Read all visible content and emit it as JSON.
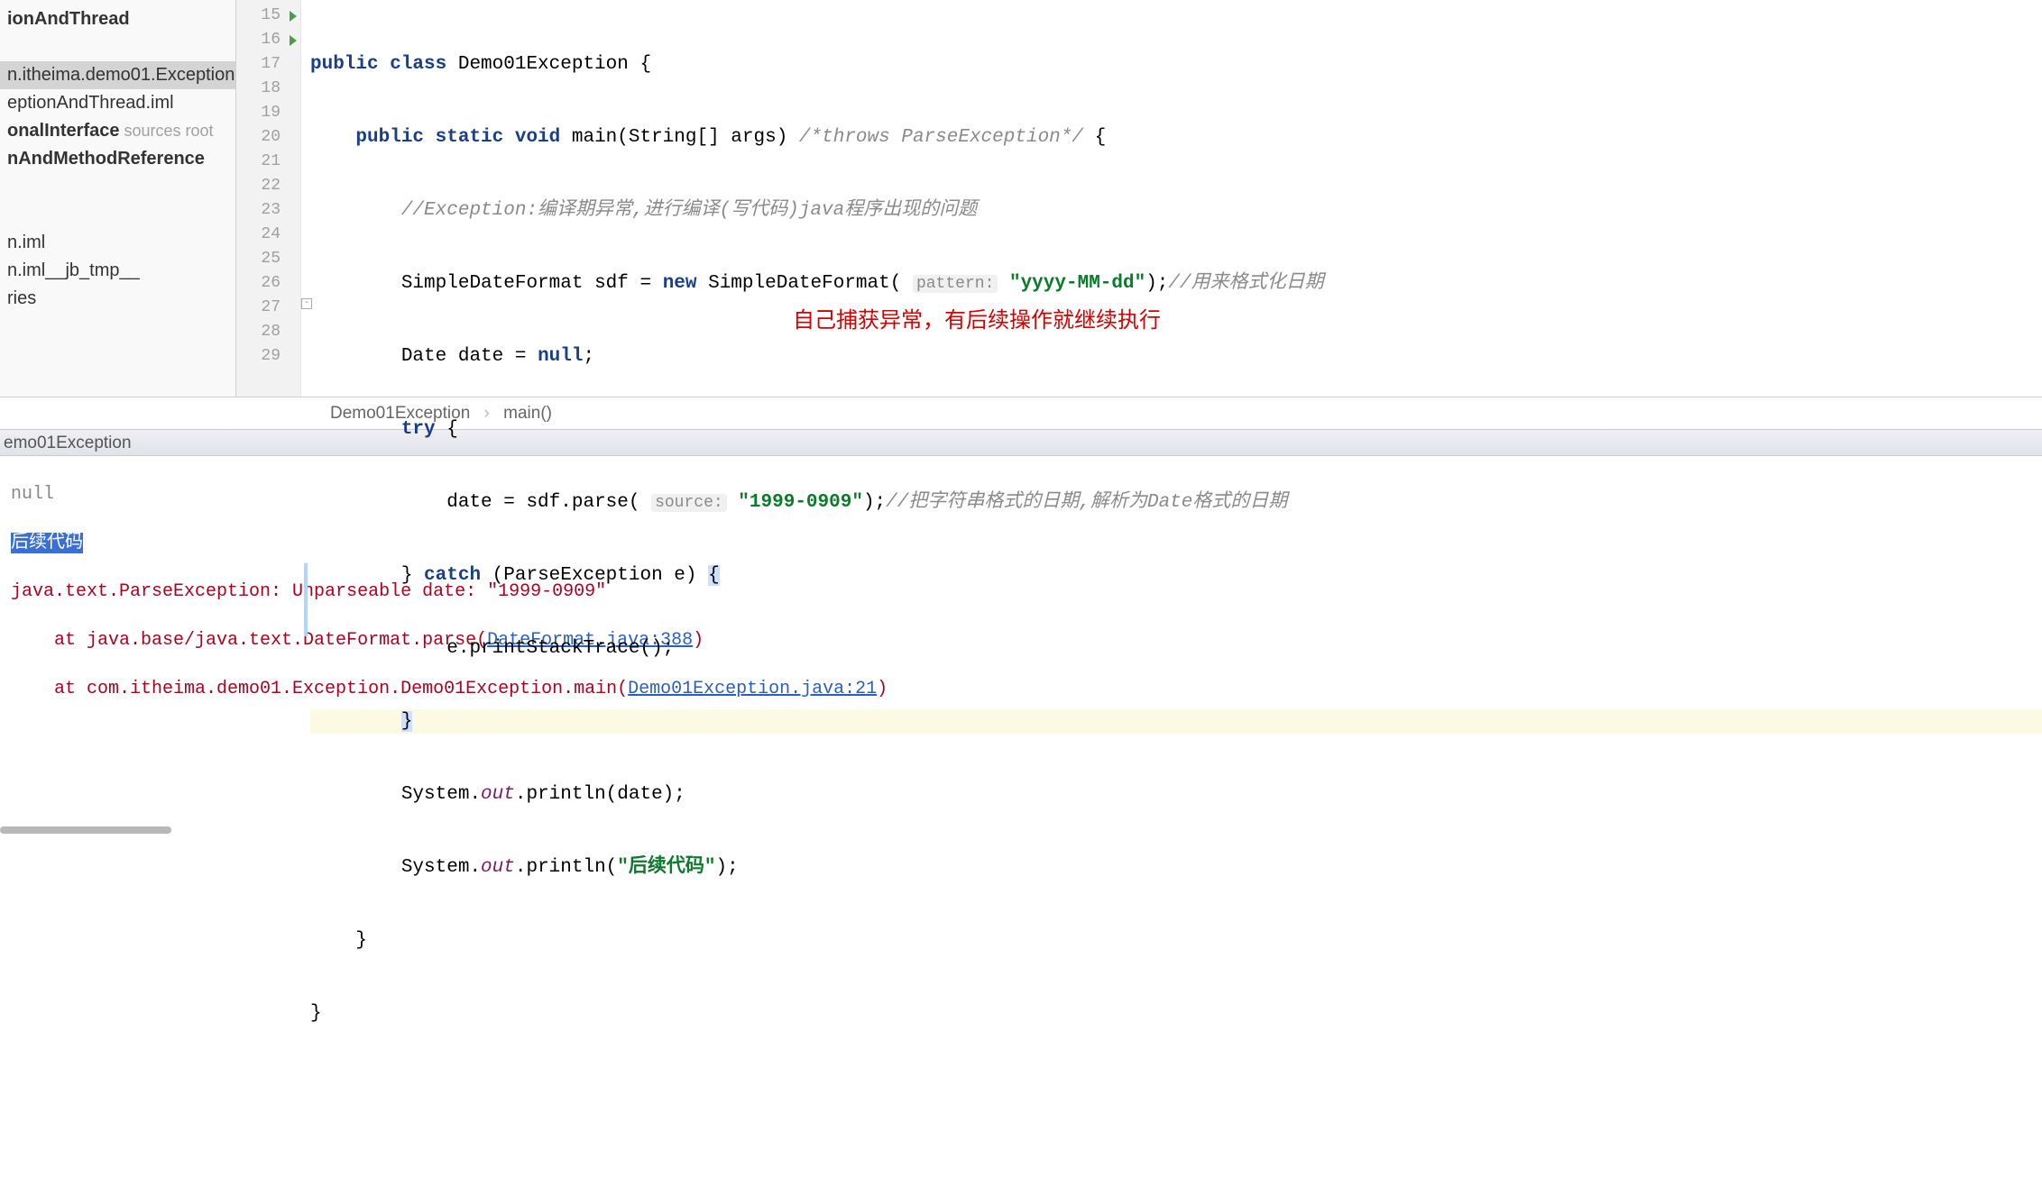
{
  "project": {
    "items": [
      {
        "label": "ionAndThread",
        "bold": true
      },
      {
        "label": ""
      },
      {
        "label": "n.itheima.demo01.Exception",
        "selected": true
      },
      {
        "label": "eptionAndThread.iml"
      },
      {
        "label": "onalInterface",
        "bold": true,
        "hint": " sources root"
      },
      {
        "label": "nAndMethodReference",
        "bold": true
      },
      {
        "label": ""
      },
      {
        "label": ""
      },
      {
        "label": "n.iml"
      },
      {
        "label": "n.iml__jb_tmp__"
      },
      {
        "label": "ries"
      }
    ]
  },
  "gutter": {
    "start": 15,
    "end": 29,
    "run_markers": [
      15,
      16
    ]
  },
  "code": {
    "l15": {
      "kw1": "public class",
      "name": " Demo01Exception {"
    },
    "l16": {
      "kw1": "public static void",
      "name": " main(String[] args) ",
      "cmt": "/*throws ParseException*/",
      "brace": " {"
    },
    "l17": {
      "cmt": "//Exception:编译期异常,进行编译(写代码)java程序出现的问题"
    },
    "l18": {
      "txt1": "SimpleDateFormat sdf = ",
      "kw": "new",
      "txt2": " SimpleDateFormat( ",
      "hint": "pattern:",
      "str": " \"yyyy-MM-dd\"",
      "txt3": ");",
      "cmt": "//用来格式化日期"
    },
    "l19": {
      "txt": "Date date = ",
      "kw": "null",
      "txt2": ";"
    },
    "l20": {
      "kw": "try",
      "txt": " {"
    },
    "l21": {
      "txt1": "    date = sdf.parse( ",
      "hint": "source:",
      "str": " \"1999-0909\"",
      "txt2": ");",
      "cmt": "//把字符串格式的日期,解析为Date格式的日期"
    },
    "l22": {
      "txt1": "} ",
      "kw": "catch",
      "txt2": " (ParseException e) ",
      "brace": "{"
    },
    "l23": {
      "txt": "    e.printStackTrace();"
    },
    "l24": {
      "brace": "}"
    },
    "l25": {
      "txt1": "System.",
      "field": "out",
      "txt2": ".println(date);"
    },
    "l26": {
      "txt1": "System.",
      "field": "out",
      "txt2": ".println(",
      "str": "\"后续代码\"",
      "txt3": ");"
    },
    "l27": {
      "txt": "}"
    },
    "l28": {
      "txt": "}"
    }
  },
  "annotation": "自己捕获异常，有后续操作就继续执行",
  "breadcrumb": {
    "a": "Demo01Exception",
    "b": "main()"
  },
  "run_tab": "emo01Exception",
  "console": {
    "line0": "null",
    "line1": "后续代码",
    "line2": "java.text.ParseException: Unparseable date: \"1999-0909\"",
    "line3a": "    at java.base/java.text.DateFormat.parse(",
    "line3link": "DateFormat.java:388",
    "line3b": ")",
    "line4a": "    at com.itheima.demo01.Exception.Demo01Exception.main(",
    "line4link": "Demo01Exception.java:21",
    "line4b": ")"
  }
}
